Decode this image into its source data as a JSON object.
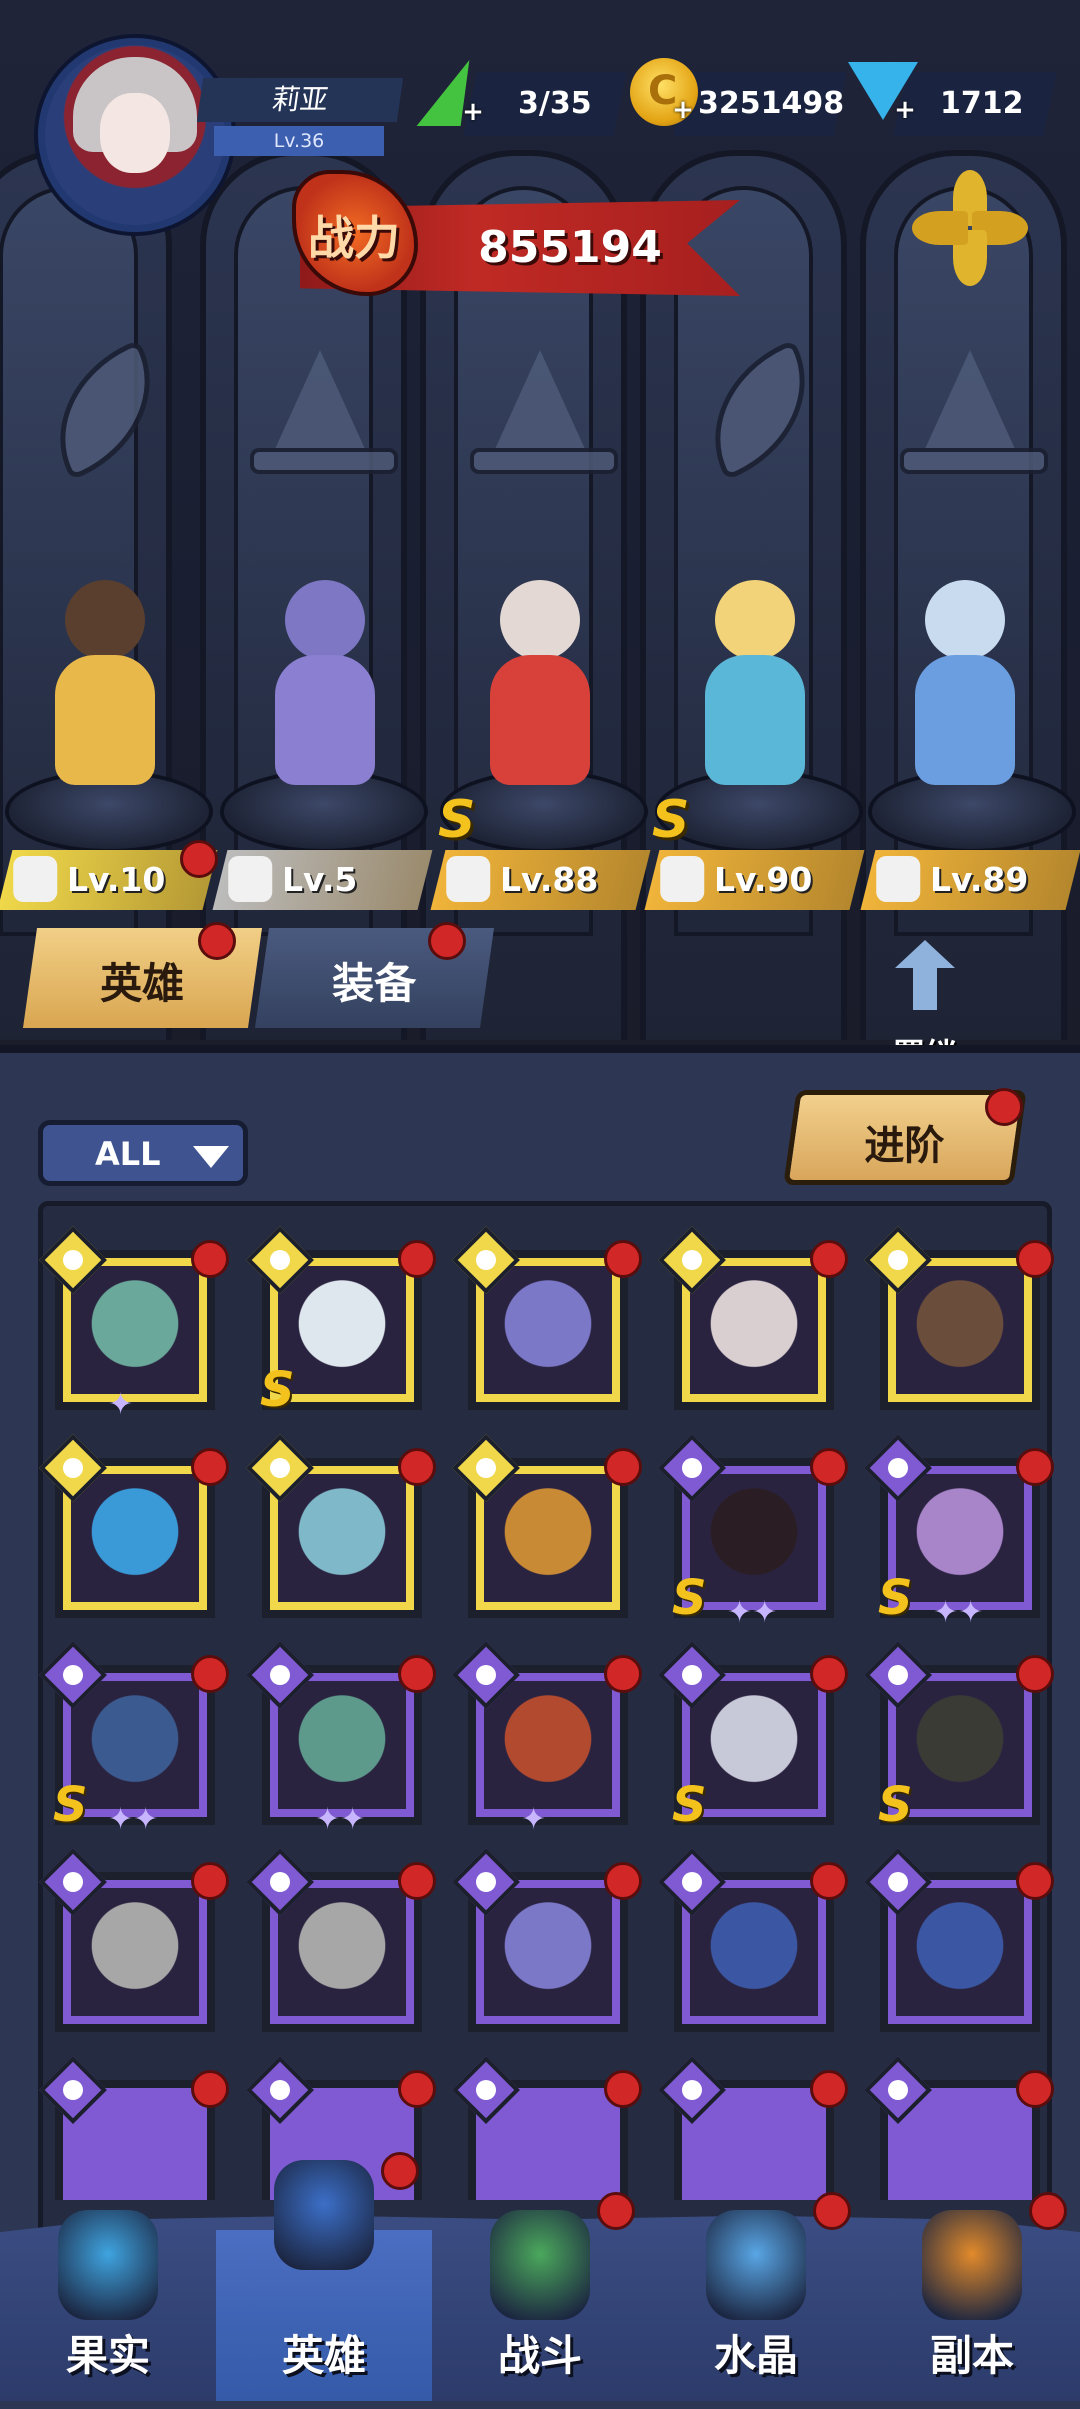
{
  "player": {
    "name": "莉亚",
    "level": "Lv.36"
  },
  "resources": {
    "energy": {
      "value": "3/35",
      "icon": "lightning-icon"
    },
    "gold": {
      "value": "3251498",
      "icon": "coin-icon"
    },
    "gems": {
      "value": "1712",
      "icon": "diamond-icon"
    }
  },
  "power": {
    "label": "战力",
    "value": "855194"
  },
  "lineup": [
    {
      "level": "Lv.10",
      "tag_color": "#f0d84a",
      "class_icon": "wing-icon",
      "rank": "",
      "red_dot": true
    },
    {
      "level": "Lv.5",
      "tag_color": "#bcbcbc",
      "class_icon": "hat-icon",
      "rank": "",
      "red_dot": false
    },
    {
      "level": "Lv.88",
      "tag_color": "#f0b43a",
      "class_icon": "hat-icon",
      "rank": "S",
      "red_dot": false
    },
    {
      "level": "Lv.90",
      "tag_color": "#f0b43a",
      "class_icon": "wing-icon",
      "rank": "S",
      "red_dot": false
    },
    {
      "level": "Lv.89",
      "tag_color": "#f0b43a",
      "class_icon": "hat-icon",
      "rank": "",
      "red_dot": false
    }
  ],
  "tabs": {
    "heroes": "英雄",
    "equipment": "装备"
  },
  "bond": {
    "label": "羁绊"
  },
  "filter": {
    "label": "ALL"
  },
  "advance": {
    "label": "进阶"
  },
  "hero_cards": [
    {
      "frame": "gold",
      "class_icon": "beast-icon",
      "rank": "",
      "stars": "✦",
      "color": "#69a89a"
    },
    {
      "frame": "gold",
      "class_icon": "wrench-icon",
      "rank": "S",
      "stars": "",
      "color": "#dfe7ee"
    },
    {
      "frame": "gold",
      "class_icon": "hat-icon",
      "rank": "",
      "stars": "",
      "color": "#7b78c8"
    },
    {
      "frame": "gold",
      "class_icon": "wing-icon",
      "rank": "",
      "stars": "",
      "color": "#d9cfd0"
    },
    {
      "frame": "gold",
      "class_icon": "wing-icon",
      "rank": "",
      "stars": "",
      "color": "#6a4d3b"
    },
    {
      "frame": "gold",
      "class_icon": "wrench-icon",
      "rank": "",
      "stars": "",
      "color": "#3a9ad8"
    },
    {
      "frame": "gold",
      "class_icon": "wrench-icon",
      "rank": "",
      "stars": "",
      "color": "#7fb9c9"
    },
    {
      "frame": "gold",
      "class_icon": "wrench-icon",
      "rank": "",
      "stars": "",
      "color": "#c98a35"
    },
    {
      "frame": "purple",
      "class_icon": "hat-icon",
      "rank": "S",
      "stars": "✦✦",
      "color": "#2a1d24"
    },
    {
      "frame": "purple",
      "class_icon": "wing-icon",
      "rank": "S",
      "stars": "✦✦",
      "color": "#a885c9"
    },
    {
      "frame": "purple",
      "class_icon": "wrench-icon",
      "rank": "S",
      "stars": "✦✦",
      "color": "#3b5a8f"
    },
    {
      "frame": "purple",
      "class_icon": "beast-icon",
      "rank": "",
      "stars": "✦✦",
      "color": "#5d9a8c"
    },
    {
      "frame": "purple",
      "class_icon": "hat-icon",
      "rank": "",
      "stars": "✦",
      "color": "#b14a2f"
    },
    {
      "frame": "purple",
      "class_icon": "wing-icon",
      "rank": "S",
      "stars": "",
      "color": "#c7c8d8"
    },
    {
      "frame": "purple",
      "class_icon": "wrench-icon",
      "rank": "S",
      "stars": "",
      "color": "#3b3b35"
    },
    {
      "frame": "purple",
      "class_icon": "hat-icon",
      "rank": "",
      "stars": "",
      "color": "#a7a7a7"
    },
    {
      "frame": "purple",
      "class_icon": "hat-icon",
      "rank": "",
      "stars": "",
      "color": "#a7a7a7"
    },
    {
      "frame": "purple",
      "class_icon": "hat-icon",
      "rank": "",
      "stars": "",
      "color": "#7b78c8"
    },
    {
      "frame": "purple",
      "class_icon": "hat-icon",
      "rank": "",
      "stars": "",
      "color": "#3b57a3"
    },
    {
      "frame": "purple",
      "class_icon": "hat-icon",
      "rank": "",
      "stars": "",
      "color": "#3b57a3"
    }
  ],
  "nav": [
    {
      "label": "果实",
      "icon": "fruit-icon",
      "color": "#3fa4e0"
    },
    {
      "label": "英雄",
      "icon": "wizard-hat-icon",
      "color": "#3c6fc8"
    },
    {
      "label": "战斗",
      "icon": "sword-icon",
      "color": "#4ba85c"
    },
    {
      "label": "水晶",
      "icon": "crystal-icon",
      "color": "#59a6e5"
    },
    {
      "label": "副本",
      "icon": "portal-icon",
      "color": "#e28a2b"
    }
  ]
}
